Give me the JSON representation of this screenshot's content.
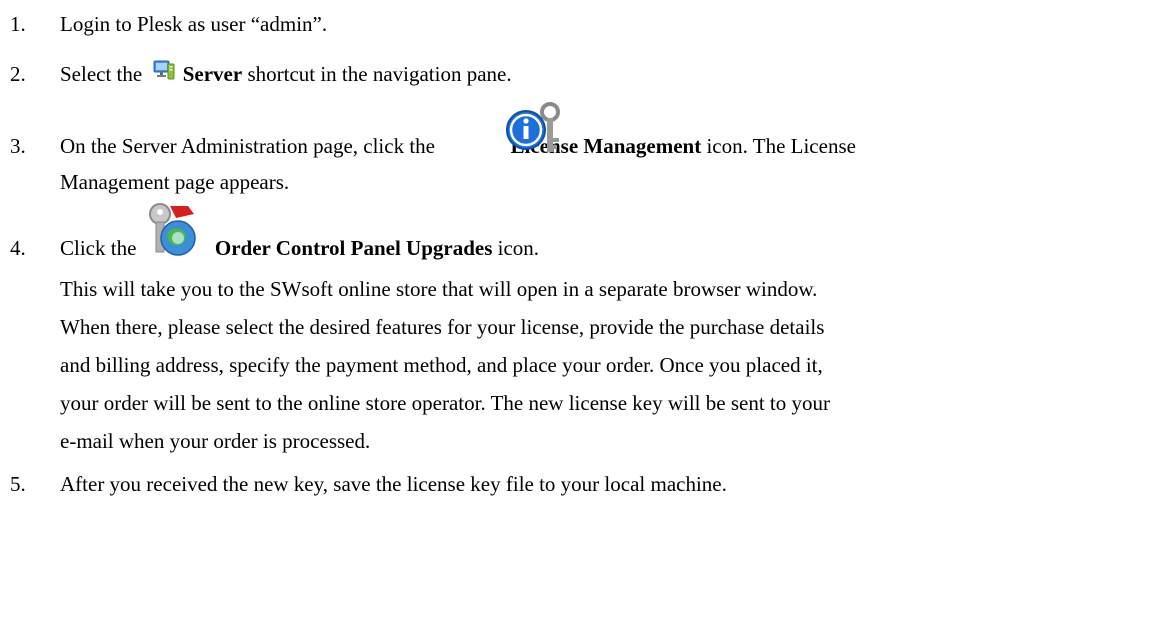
{
  "steps": [
    {
      "number": "1.",
      "text": "Login to Plesk as user “admin”."
    },
    {
      "number": "2.",
      "before": "Select the",
      "bold": "Server",
      "after": "shortcut in the navigation pane.",
      "icon": "server-icon"
    },
    {
      "number": "3.",
      "before": "On the Server Administration page, click the",
      "bold": "License Management",
      "after": "icon. The License",
      "line2": "Management page appears.",
      "icon": "license-management-icon"
    },
    {
      "number": "4.",
      "before": "Click the",
      "bold": "Order Control Panel Upgrades",
      "after": "icon.",
      "icon": "order-upgrades-icon",
      "paragraph": [
        "This will take you to the SWsoft online store that will open in a separate browser window.",
        "When there, please select the desired features for your license, provide the purchase details",
        "and billing address, specify the payment method, and place your order. Once you placed it,",
        "your order will be sent to the online store operator. The new license key will be sent to your",
        "e-mail when your order is processed."
      ]
    },
    {
      "number": "5.",
      "text": "After you received the new key, save the license key file to your local machine."
    }
  ]
}
